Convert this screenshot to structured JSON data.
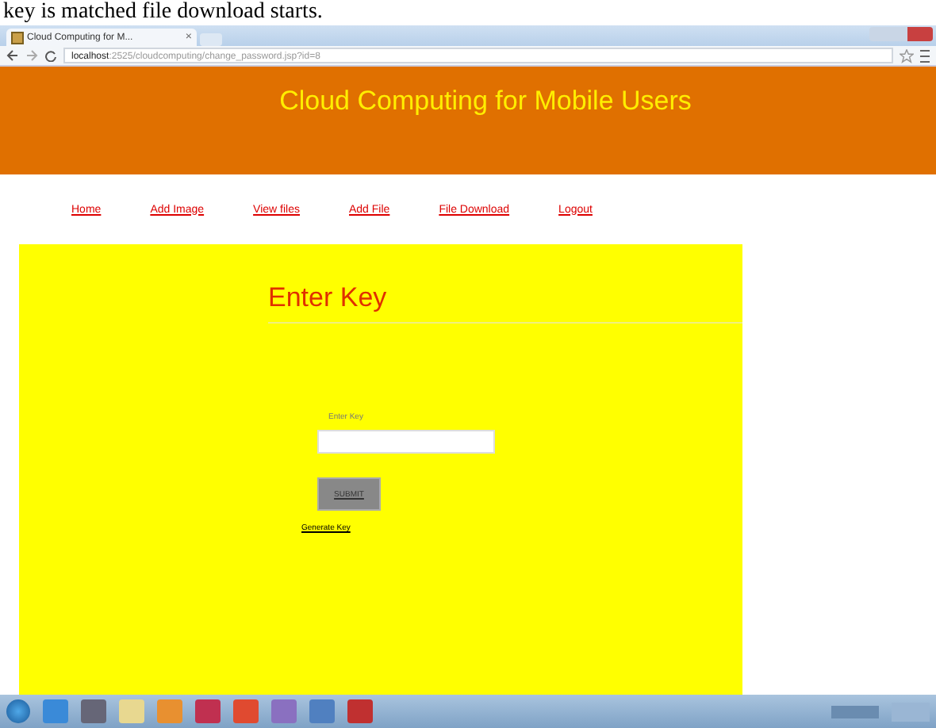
{
  "caption": "key is matched file download starts.",
  "browser": {
    "tab_title": "Cloud Computing for M...",
    "tab_close": "×",
    "url_host": "localhost",
    "url_path": ":2525/cloudcomputing/change_password.jsp?id=8"
  },
  "header": {
    "title": "Cloud Computing for Mobile Users"
  },
  "nav": [
    "Home",
    "Add Image",
    "View files",
    "Add File",
    "File Download",
    "Logout"
  ],
  "form": {
    "heading": "Enter Key",
    "field_label": "Enter Key",
    "submit": "SUBMIT",
    "link": "Generate Key"
  }
}
